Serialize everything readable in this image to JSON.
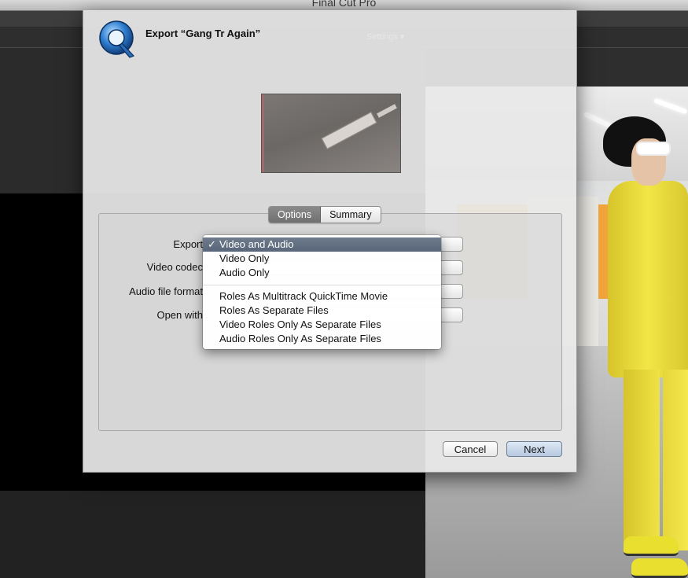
{
  "app": {
    "title": "Final Cut Pro"
  },
  "dialog": {
    "title": "Export “Gang Tr Again”",
    "settings_ghost": "Settings ▾",
    "tabs": [
      {
        "label": "Options",
        "active": true
      },
      {
        "label": "Summary",
        "active": false
      }
    ],
    "fields": [
      {
        "label": "Export"
      },
      {
        "label": "Video codec"
      },
      {
        "label": "Audio file format"
      },
      {
        "label": "Open with"
      }
    ],
    "cancel_label": "Cancel",
    "next_label": "Next"
  },
  "menu": {
    "check_mark": "✓",
    "group1": [
      {
        "label": "Video and Audio",
        "selected": true
      },
      {
        "label": "Video Only",
        "selected": false
      },
      {
        "label": "Audio Only",
        "selected": false
      }
    ],
    "group2": [
      {
        "label": "Roles As Multitrack QuickTime Movie"
      },
      {
        "label": "Roles As Separate Files"
      },
      {
        "label": "Video Roles Only As Separate Files"
      },
      {
        "label": "Audio Roles Only As Separate Files"
      }
    ]
  },
  "colors": {
    "menu_highlight": "#5f6c7f",
    "next_button": "#b6c9e0"
  },
  "icons": {
    "app_icon": "quicktime-icon"
  }
}
